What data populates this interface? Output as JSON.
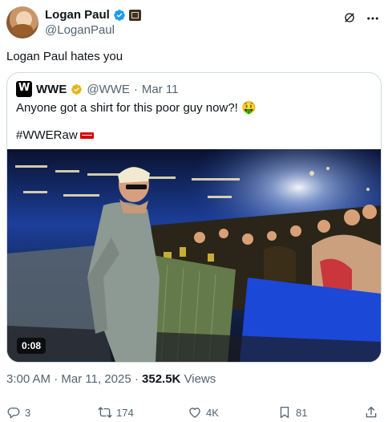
{
  "author": {
    "display_name": "Logan Paul",
    "handle": "@LoganPaul"
  },
  "tweet": {
    "text": "Logan Paul hates you",
    "time": "3:00 AM",
    "date": "Mar 11, 2025",
    "views_count": "352.5K",
    "views_label": "Views",
    "separator": "·"
  },
  "quoted": {
    "display_name": "WWE",
    "handle": "@WWE",
    "date": "Mar 11",
    "separator": "·",
    "text": "Anyone got a shirt for this poor guy now?! 🤑",
    "hashtag": "#WWERaw",
    "video_duration": "0:08"
  },
  "actions": {
    "replies": "3",
    "reposts": "174",
    "likes": "4K",
    "bookmarks": "81"
  },
  "colors": {
    "secondary_text": "#536471",
    "border": "#cfd9de",
    "verified_blue": "#1d9bf0",
    "verified_gold": "#e2b719"
  },
  "icons": [
    "verified-badge-icon",
    "affiliate-badge-icon",
    "grok-icon",
    "more-icon",
    "reply-icon",
    "repost-icon",
    "like-icon",
    "bookmark-icon",
    "share-icon"
  ]
}
